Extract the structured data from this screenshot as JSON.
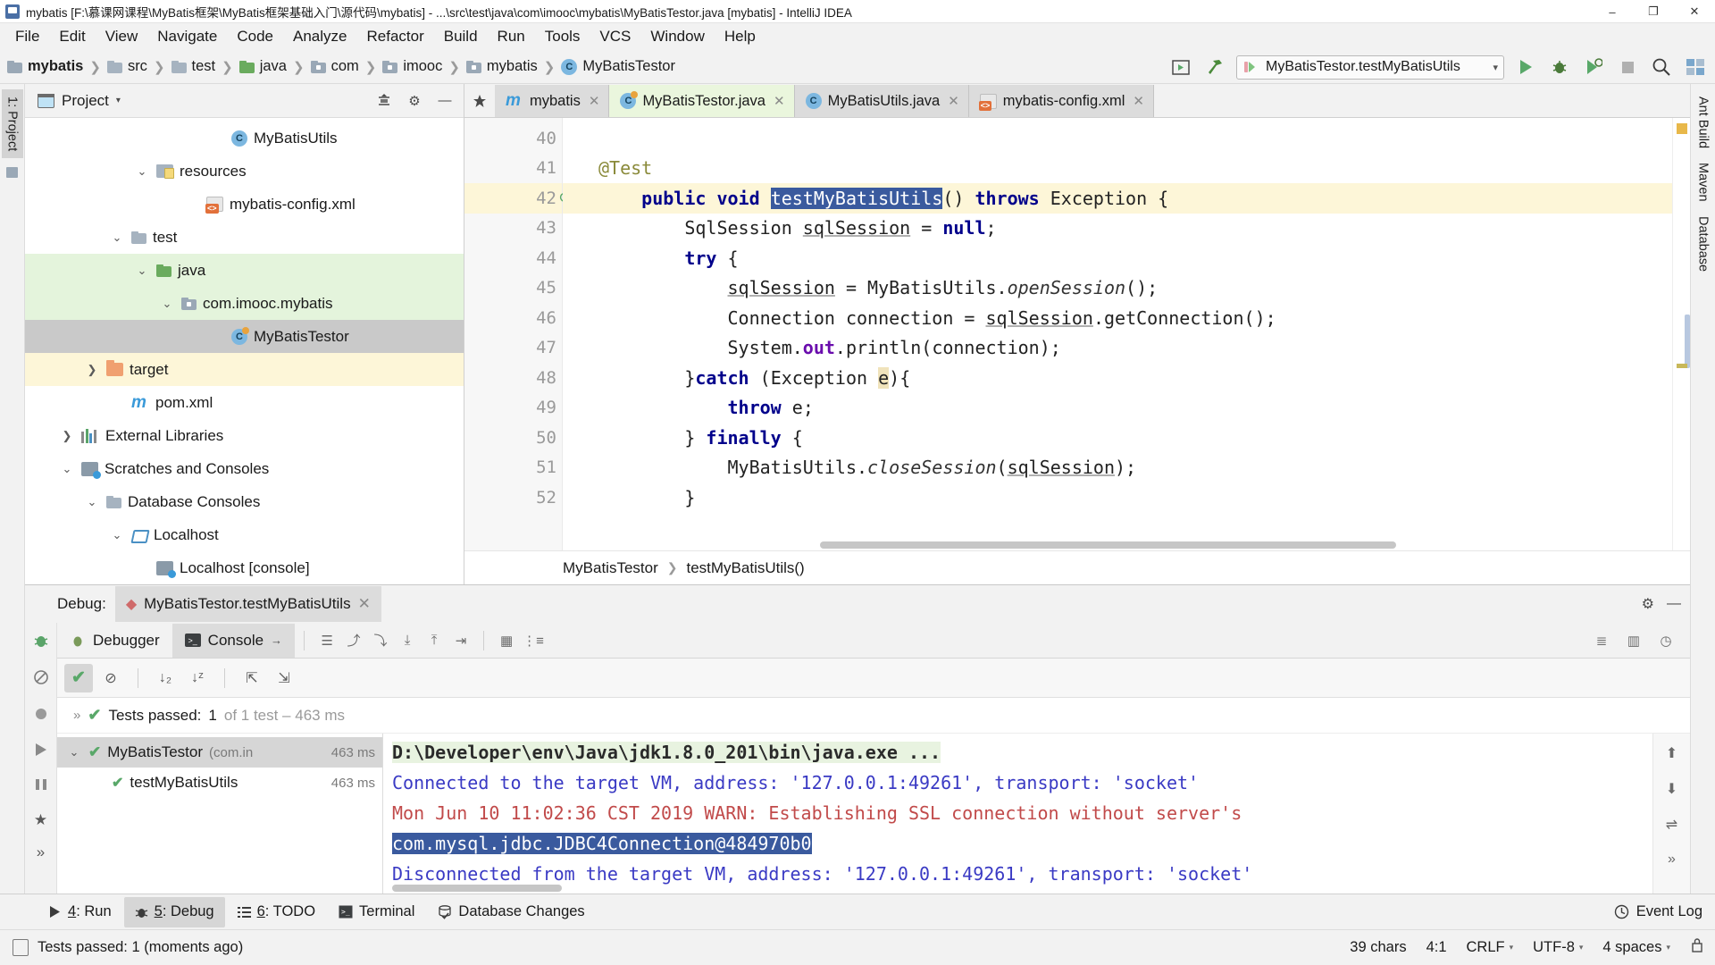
{
  "window": {
    "title": "mybatis [F:\\慕课网课程\\MyBatis框架\\MyBatis框架基础入门\\源代码\\mybatis] - ...\\src\\test\\java\\com\\imooc\\mybatis\\MyBatisTestor.java [mybatis] - IntelliJ IDEA",
    "minimize": "–",
    "maximize": "❐",
    "close": "✕"
  },
  "menu": {
    "items": [
      "File",
      "Edit",
      "View",
      "Navigate",
      "Code",
      "Analyze",
      "Refactor",
      "Build",
      "Run",
      "Tools",
      "VCS",
      "Window",
      "Help"
    ]
  },
  "navbar": {
    "breadcrumbs": [
      {
        "label": "mybatis",
        "icon": "module-icon",
        "bold": true
      },
      {
        "label": "src",
        "icon": "folder-icon",
        "bold": false
      },
      {
        "label": "test",
        "icon": "folder-icon",
        "bold": false
      },
      {
        "label": "java",
        "icon": "source-folder-icon",
        "bold": false
      },
      {
        "label": "com",
        "icon": "package-icon",
        "bold": false
      },
      {
        "label": "imooc",
        "icon": "package-icon",
        "bold": false
      },
      {
        "label": "mybatis",
        "icon": "package-icon",
        "bold": false
      },
      {
        "label": "MyBatisTestor",
        "icon": "class-icon",
        "bold": false
      }
    ],
    "separator": "❯",
    "run_config": "MyBatisTestor.testMyBatisUtils",
    "run_caret": "▾",
    "run_icon": "run-button",
    "debug_icon": "debug-button",
    "coverage_icon": "run-with-coverage-button",
    "stop_icon": "stop-button",
    "search_icon": "🔍",
    "layout_icon": "▦",
    "preview_icon": "▶",
    "build_icon": "🔨"
  },
  "left_rail": {
    "items": [
      {
        "label": "1: Project",
        "active": true
      }
    ]
  },
  "right_rail": {
    "items": [
      {
        "label": "Ant Build"
      },
      {
        "label": "Maven"
      },
      {
        "label": "Database"
      }
    ]
  },
  "project_panel": {
    "title": "Project",
    "caret": "▾",
    "collapse_icon": "collapse-all-icon",
    "settings_icon": "⚙",
    "hide_icon": "—",
    "tree": [
      {
        "label": "MyBatisUtils",
        "icon": "class-icon",
        "indent": 7,
        "arrow": "",
        "hl": ""
      },
      {
        "label": "resources",
        "icon": "resources-folder-icon",
        "indent": 4,
        "arrow": "⌄",
        "hl": ""
      },
      {
        "label": "mybatis-config.xml",
        "icon": "xml-file-icon",
        "indent": 6,
        "arrow": "",
        "hl": ""
      },
      {
        "label": "test",
        "icon": "folder-icon",
        "indent": 3,
        "arrow": "⌄",
        "hl": ""
      },
      {
        "label": "java",
        "icon": "source-folder-icon",
        "indent": 4,
        "arrow": "⌄",
        "hl": "green"
      },
      {
        "label": "com.imooc.mybatis",
        "icon": "package-icon",
        "indent": 5,
        "arrow": "⌄",
        "hl": "green"
      },
      {
        "label": "MyBatisTestor",
        "icon": "test-class-icon",
        "indent": 7,
        "arrow": "",
        "hl": "gray"
      },
      {
        "label": "target",
        "icon": "target-folder-icon",
        "indent": 2,
        "arrow": "❯",
        "hl": "yellow"
      },
      {
        "label": "pom.xml",
        "icon": "maven-file-icon",
        "indent": 3,
        "arrow": "",
        "hl": ""
      },
      {
        "label": "External Libraries",
        "icon": "libraries-icon",
        "indent": 1,
        "arrow": "❯",
        "hl": ""
      },
      {
        "label": "Scratches and Consoles",
        "icon": "scratches-icon",
        "indent": 1,
        "arrow": "⌄",
        "hl": ""
      },
      {
        "label": "Database Consoles",
        "icon": "folder-icon",
        "indent": 2,
        "arrow": "⌄",
        "hl": ""
      },
      {
        "label": "Localhost",
        "icon": "host-icon",
        "indent": 3,
        "arrow": "⌄",
        "hl": ""
      },
      {
        "label": "Localhost [console]",
        "icon": "console-file-icon",
        "indent": 4,
        "arrow": "",
        "hl": ""
      }
    ]
  },
  "editor": {
    "tabs": [
      {
        "label": "mybatis",
        "icon": "maven-file-icon",
        "active": false,
        "close": "✕"
      },
      {
        "label": "MyBatisTestor.java",
        "icon": "test-class-icon",
        "active": true,
        "close": "✕"
      },
      {
        "label": "MyBatisUtils.java",
        "icon": "class-icon",
        "active": false,
        "close": "✕"
      },
      {
        "label": "mybatis-config.xml",
        "icon": "xml-file-icon",
        "active": false,
        "close": "✕"
      }
    ],
    "line_numbers": [
      "40",
      "41",
      "42",
      "43",
      "44",
      "45",
      "46",
      "47",
      "48",
      "49",
      "50",
      "51",
      "52"
    ],
    "current_line": "42",
    "code_lines": [
      {
        "n": "40",
        "text": ""
      },
      {
        "n": "41",
        "text": "    @Test"
      },
      {
        "n": "42",
        "text": "    public void testMyBatisUtils() throws Exception {"
      },
      {
        "n": "43",
        "text": "        SqlSession sqlSession = null;"
      },
      {
        "n": "44",
        "text": "        try {"
      },
      {
        "n": "45",
        "text": "            sqlSession = MyBatisUtils.openSession();"
      },
      {
        "n": "46",
        "text": "            Connection connection = sqlSession.getConnection();"
      },
      {
        "n": "47",
        "text": "            System.out.println(connection);"
      },
      {
        "n": "48",
        "text": "        }catch (Exception e){"
      },
      {
        "n": "49",
        "text": "            throw e;"
      },
      {
        "n": "50",
        "text": "        } finally {"
      },
      {
        "n": "51",
        "text": "            MyBatisUtils.closeSession(sqlSession);"
      },
      {
        "n": "52",
        "text": "        }"
      }
    ],
    "selected_text": "testMyBatisUtils",
    "breadcrumb": [
      "MyBatisTestor",
      "testMyBatisUtils()"
    ],
    "breadcrumb_sep": "❯"
  },
  "debug": {
    "label": "Debug:",
    "session_tab": "MyBatisTestor.testMyBatisUtils",
    "session_close": "✕",
    "settings_icon": "⚙",
    "hide_icon": "—",
    "tabs": [
      {
        "label": "Debugger",
        "active": false,
        "icon": "debugger-icon"
      },
      {
        "label": "Console",
        "active": true,
        "icon": "console-icon"
      }
    ],
    "console_arrow": "→",
    "test_status": {
      "chevron": "»",
      "tick": "✔",
      "label": "Tests passed:",
      "count": "1",
      "detail": "of 1 test – 463 ms"
    },
    "test_tree": [
      {
        "label": "MyBatisTestor",
        "sub": "(com.in",
        "time": "463 ms",
        "icon": "test-suite-icon",
        "arrow": "⌄",
        "sel": true,
        "indent": 0
      },
      {
        "label": "testMyBatisUtils",
        "sub": "",
        "time": "463 ms",
        "icon": "test-passed-icon",
        "arrow": "",
        "sel": false,
        "indent": 1
      }
    ],
    "console_lines": [
      {
        "text": "D:\\Developer\\env\\Java\\jdk1.8.0_201\\bin\\java.exe ...",
        "style": "cmd"
      },
      {
        "text": "Connected to the target VM, address: '127.0.0.1:49261', transport: 'socket'",
        "style": "blue"
      },
      {
        "text": "Mon Jun 10 11:02:36 CST 2019 WARN: Establishing SSL connection without server's",
        "style": "red"
      },
      {
        "text": "com.mysql.jdbc.JDBC4Connection@484970b0",
        "style": "selected"
      },
      {
        "text": "Disconnected from the target VM, address: '127.0.0.1:49261', transport: 'socket'",
        "style": "blue"
      }
    ]
  },
  "bottom_toolbar": {
    "buttons": [
      {
        "num": "4",
        "label": ": Run",
        "icon": "run-icon",
        "active": false
      },
      {
        "num": "5",
        "label": ": Debug",
        "icon": "debug-icon",
        "active": true
      },
      {
        "num": "6",
        "label": ": TODO",
        "icon": "todo-icon",
        "active": false
      },
      {
        "num": "",
        "label": "Terminal",
        "icon": "terminal-icon",
        "active": false
      },
      {
        "num": "",
        "label": "Database Changes",
        "icon": "database-changes-icon",
        "active": false
      }
    ],
    "event_log": "Event Log",
    "event_log_icon": "event-log-icon"
  },
  "statusbar": {
    "message": "Tests passed: 1 (moments ago)",
    "chars": "39 chars",
    "caret_pos": "4:1",
    "line_sep": "CRLF",
    "encoding": "UTF-8",
    "indent": "4 spaces",
    "caret": "⌃⌄",
    "lock_icon": "status-message-icon"
  }
}
